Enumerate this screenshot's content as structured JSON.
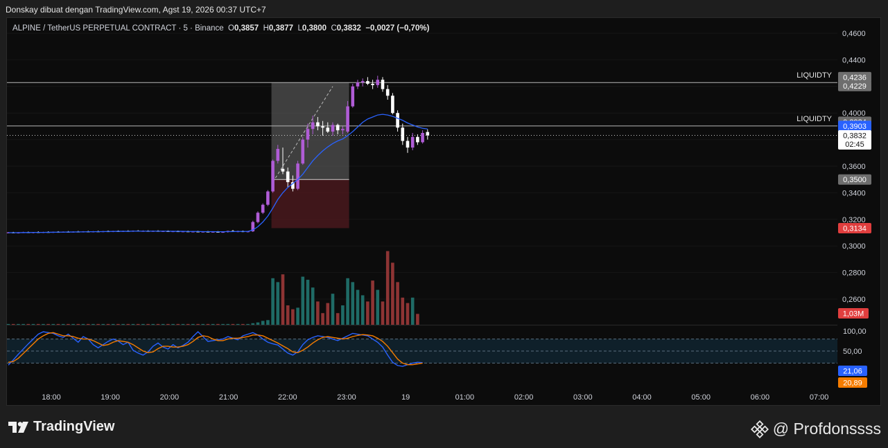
{
  "header": {
    "caption": "Donskay dibuat dengan TradingView.com, Agst 19, 2026 00:37 UTC+7"
  },
  "legend": {
    "symbol": "ALPINE / TetherUS PERPETUAL CONTRACT · 5 · Binance",
    "o_label": "O",
    "o": "0,3857",
    "h_label": "H",
    "h": "0,3877",
    "l_label": "L",
    "l": "0,3800",
    "c_label": "C",
    "c": "0,3832",
    "change": "−0,0027 (−0,70%)"
  },
  "footer": {
    "brand": "TradingView",
    "watermark": "@ Profdonssss"
  },
  "colors": {
    "up": "#b05cd6",
    "down": "#ffffff",
    "vol_up": "#1f6b66",
    "vol_down": "#8e3434",
    "ma": "#2962ff",
    "stoch_k": "#2962ff",
    "stoch_d": "#f57c00"
  },
  "chart_data": {
    "type": "candlestick",
    "price_axis": {
      "ylim": [
        0.29,
        0.47
      ],
      "ticks": [
        "0,4600",
        "0,4400",
        "0,4200",
        "0,4000",
        "0,3800",
        "0,3600",
        "0,3400",
        "0,3200",
        "0,3000",
        "0,2800",
        "0,2600"
      ]
    },
    "time_axis": [
      "18:00",
      "19:00",
      "20:00",
      "21:00",
      "22:00",
      "23:00",
      "19",
      "01:00",
      "02:00",
      "03:00",
      "04:00",
      "05:00",
      "06:00",
      "07:00"
    ],
    "lines": [
      {
        "label": "LIQUIDTY",
        "price": 0.4229
      },
      {
        "label": "LIQUIDTY",
        "price": 0.3903
      }
    ],
    "axis_tags": [
      {
        "text": "0,4236",
        "price": 0.4236,
        "kind": "grey"
      },
      {
        "text": "0,4229",
        "price": 0.4229,
        "kind": "grey"
      },
      {
        "text": "0,3934",
        "price": 0.3934,
        "kind": "grey"
      },
      {
        "text": "0,3903",
        "price": 0.3903,
        "kind": "blue"
      },
      {
        "text": "0,3832",
        "price": 0.3832,
        "kind": "white",
        "sub": "02:45"
      },
      {
        "text": "0,3500",
        "price": 0.35,
        "kind": "grey"
      },
      {
        "text": "0,3134",
        "price": 0.3134,
        "kind": "red"
      }
    ],
    "position_box": {
      "entry": 0.35,
      "target": 0.4229,
      "stop": 0.3134,
      "start_bar": 53,
      "end_bar": 68
    },
    "candles": [
      [
        0.31,
        0.3105,
        0.3095,
        0.3102
      ],
      [
        0.3102,
        0.3106,
        0.3096,
        0.3099
      ],
      [
        0.3099,
        0.3104,
        0.3094,
        0.3101
      ],
      [
        0.3101,
        0.3107,
        0.3097,
        0.3103
      ],
      [
        0.3103,
        0.3108,
        0.3098,
        0.31
      ],
      [
        0.31,
        0.3105,
        0.3095,
        0.3104
      ],
      [
        0.3104,
        0.311,
        0.3099,
        0.3102
      ],
      [
        0.3102,
        0.3107,
        0.3097,
        0.3105
      ],
      [
        0.3105,
        0.311,
        0.31,
        0.3103
      ],
      [
        0.3103,
        0.3108,
        0.3098,
        0.3106
      ],
      [
        0.3106,
        0.3111,
        0.3101,
        0.3104
      ],
      [
        0.3104,
        0.3109,
        0.31,
        0.3107
      ],
      [
        0.3107,
        0.3112,
        0.3102,
        0.3105
      ],
      [
        0.3105,
        0.311,
        0.31,
        0.3108
      ],
      [
        0.3108,
        0.3113,
        0.3103,
        0.3106
      ],
      [
        0.3106,
        0.3111,
        0.3101,
        0.3109
      ],
      [
        0.3109,
        0.3114,
        0.3104,
        0.3107
      ],
      [
        0.3107,
        0.3112,
        0.3102,
        0.311
      ],
      [
        0.311,
        0.3115,
        0.3105,
        0.3108
      ],
      [
        0.3108,
        0.3113,
        0.3103,
        0.3111
      ],
      [
        0.3111,
        0.3116,
        0.3106,
        0.3109
      ],
      [
        0.3109,
        0.3114,
        0.3104,
        0.3112
      ],
      [
        0.3112,
        0.3117,
        0.3107,
        0.311
      ],
      [
        0.311,
        0.3115,
        0.3105,
        0.3113
      ],
      [
        0.3113,
        0.3118,
        0.3108,
        0.3111
      ],
      [
        0.3111,
        0.3116,
        0.3106,
        0.3114
      ],
      [
        0.3114,
        0.3119,
        0.3109,
        0.3112
      ],
      [
        0.3112,
        0.3117,
        0.3107,
        0.3113
      ],
      [
        0.3113,
        0.3118,
        0.3108,
        0.3111
      ],
      [
        0.3111,
        0.3116,
        0.3106,
        0.3113
      ],
      [
        0.3113,
        0.3118,
        0.3108,
        0.311
      ],
      [
        0.311,
        0.3115,
        0.3105,
        0.3112
      ],
      [
        0.3112,
        0.3117,
        0.3107,
        0.3109
      ],
      [
        0.3109,
        0.3114,
        0.3104,
        0.3111
      ],
      [
        0.3111,
        0.3116,
        0.3106,
        0.3108
      ],
      [
        0.3108,
        0.3113,
        0.3103,
        0.311
      ],
      [
        0.311,
        0.3115,
        0.3105,
        0.3107
      ],
      [
        0.3107,
        0.3112,
        0.3102,
        0.3109
      ],
      [
        0.3109,
        0.3114,
        0.3104,
        0.3106
      ],
      [
        0.3106,
        0.3111,
        0.3101,
        0.3108
      ],
      [
        0.3108,
        0.3113,
        0.3103,
        0.3105
      ],
      [
        0.3105,
        0.311,
        0.31,
        0.3107
      ],
      [
        0.3107,
        0.3112,
        0.3102,
        0.3104
      ],
      [
        0.3104,
        0.3109,
        0.3099,
        0.3106
      ],
      [
        0.3106,
        0.3115,
        0.31,
        0.3113
      ],
      [
        0.3113,
        0.312,
        0.3106,
        0.3109
      ],
      [
        0.3109,
        0.3115,
        0.3103,
        0.3111
      ],
      [
        0.3111,
        0.3116,
        0.3104,
        0.3108
      ],
      [
        0.3108,
        0.3113,
        0.3102,
        0.311
      ],
      [
        0.311,
        0.319,
        0.3105,
        0.318
      ],
      [
        0.318,
        0.326,
        0.317,
        0.325
      ],
      [
        0.325,
        0.332,
        0.324,
        0.331
      ],
      [
        0.331,
        0.342,
        0.33,
        0.341
      ],
      [
        0.341,
        0.365,
        0.34,
        0.364
      ],
      [
        0.364,
        0.376,
        0.362,
        0.373
      ],
      [
        0.358,
        0.374,
        0.354,
        0.356
      ],
      [
        0.356,
        0.359,
        0.344,
        0.348
      ],
      [
        0.348,
        0.353,
        0.341,
        0.343
      ],
      [
        0.343,
        0.364,
        0.342,
        0.362
      ],
      [
        0.362,
        0.382,
        0.361,
        0.38
      ],
      [
        0.38,
        0.392,
        0.374,
        0.388
      ],
      [
        0.388,
        0.398,
        0.384,
        0.393
      ],
      [
        0.393,
        0.397,
        0.387,
        0.39
      ],
      [
        0.39,
        0.394,
        0.383,
        0.389
      ],
      [
        0.389,
        0.393,
        0.385,
        0.386
      ],
      [
        0.386,
        0.393,
        0.383,
        0.391
      ],
      [
        0.391,
        0.392,
        0.384,
        0.387
      ],
      [
        0.387,
        0.39,
        0.384,
        0.388
      ],
      [
        0.386,
        0.409,
        0.385,
        0.405
      ],
      [
        0.405,
        0.422,
        0.404,
        0.42
      ],
      [
        0.42,
        0.425,
        0.418,
        0.423
      ],
      [
        0.423,
        0.426,
        0.42,
        0.424
      ],
      [
        0.424,
        0.427,
        0.421,
        0.422
      ],
      [
        0.422,
        0.425,
        0.418,
        0.421
      ],
      [
        0.421,
        0.428,
        0.419,
        0.425
      ],
      [
        0.425,
        0.427,
        0.416,
        0.418
      ],
      [
        0.418,
        0.421,
        0.41,
        0.413
      ],
      [
        0.413,
        0.415,
        0.399,
        0.4
      ],
      [
        0.4,
        0.402,
        0.386,
        0.389
      ],
      [
        0.389,
        0.392,
        0.376,
        0.379
      ],
      [
        0.379,
        0.382,
        0.37,
        0.374
      ],
      [
        0.374,
        0.385,
        0.372,
        0.382
      ],
      [
        0.382,
        0.384,
        0.376,
        0.378
      ],
      [
        0.378,
        0.387,
        0.377,
        0.385
      ],
      [
        0.3857,
        0.3877,
        0.38,
        0.3832
      ]
    ],
    "ma": [
      0.31,
      0.31,
      0.31,
      0.3101,
      0.3101,
      0.3102,
      0.3102,
      0.3102,
      0.3103,
      0.3103,
      0.3104,
      0.3104,
      0.3105,
      0.3105,
      0.3106,
      0.3106,
      0.3107,
      0.3107,
      0.3108,
      0.3108,
      0.3109,
      0.3109,
      0.311,
      0.311,
      0.311,
      0.3111,
      0.3111,
      0.3111,
      0.3111,
      0.3111,
      0.3111,
      0.3111,
      0.3111,
      0.311,
      0.311,
      0.311,
      0.3109,
      0.3109,
      0.3109,
      0.3108,
      0.3108,
      0.3108,
      0.3107,
      0.3107,
      0.3108,
      0.3108,
      0.3109,
      0.3109,
      0.3109,
      0.312,
      0.3145,
      0.318,
      0.3225,
      0.3285,
      0.335,
      0.34,
      0.344,
      0.347,
      0.35,
      0.354,
      0.359,
      0.364,
      0.368,
      0.3715,
      0.3745,
      0.377,
      0.379,
      0.3805,
      0.383,
      0.386,
      0.3895,
      0.393,
      0.3955,
      0.397,
      0.3985,
      0.399,
      0.3985,
      0.3975,
      0.396,
      0.3945,
      0.3925,
      0.391,
      0.3895,
      0.3885,
      0.388
    ],
    "volume": {
      "label": "1,03M",
      "ymax": 100,
      "values": [
        1,
        1,
        1,
        1,
        1,
        1,
        1,
        1,
        1,
        1,
        1,
        1,
        1,
        1,
        1,
        1,
        1,
        1,
        1,
        1,
        1,
        1,
        1,
        1,
        1,
        1,
        1,
        1,
        1,
        1,
        1,
        1,
        1,
        1,
        1,
        1,
        1,
        1,
        1,
        1,
        1,
        1,
        1,
        1,
        1,
        1,
        1,
        1,
        1,
        2,
        3,
        5,
        6,
        60,
        55,
        65,
        25,
        20,
        22,
        62,
        58,
        48,
        30,
        15,
        28,
        40,
        15,
        25,
        60,
        55,
        45,
        38,
        30,
        57,
        45,
        30,
        95,
        80,
        55,
        35,
        28,
        35,
        14
      ]
    },
    "stochastic": {
      "levels": [
        80,
        50,
        20
      ],
      "k_label": "21,06",
      "d_label": "20,89",
      "k": [
        15,
        28,
        42,
        55,
        68,
        80,
        92,
        98,
        96,
        94,
        88,
        84,
        92,
        82,
        72,
        86,
        80,
        66,
        58,
        66,
        74,
        80,
        75,
        66,
        72,
        52,
        45,
        40,
        48,
        62,
        70,
        60,
        55,
        66,
        58,
        64,
        72,
        86,
        98,
        86,
        74,
        76,
        78,
        80,
        86,
        82,
        78,
        88,
        92,
        96,
        90,
        80,
        72,
        68,
        65,
        55,
        45,
        40,
        48,
        66,
        78,
        84,
        88,
        86,
        84,
        80,
        76,
        82,
        88,
        94,
        92,
        90,
        88,
        80,
        72,
        60,
        40,
        22,
        14,
        12,
        16,
        20,
        22,
        21
      ],
      "d": [
        22,
        24,
        32,
        44,
        56,
        68,
        80,
        88,
        94,
        96,
        92,
        88,
        88,
        86,
        82,
        80,
        80,
        76,
        70,
        64,
        66,
        72,
        76,
        74,
        72,
        66,
        58,
        50,
        46,
        48,
        56,
        62,
        62,
        60,
        60,
        62,
        66,
        74,
        84,
        88,
        86,
        80,
        76,
        76,
        80,
        82,
        82,
        84,
        86,
        90,
        90,
        88,
        82,
        76,
        70,
        63,
        56,
        48,
        46,
        52,
        60,
        70,
        78,
        84,
        86,
        84,
        82,
        80,
        82,
        86,
        89,
        91,
        90,
        88,
        82,
        74,
        62,
        46,
        30,
        20,
        16,
        16,
        18,
        20
      ]
    }
  }
}
